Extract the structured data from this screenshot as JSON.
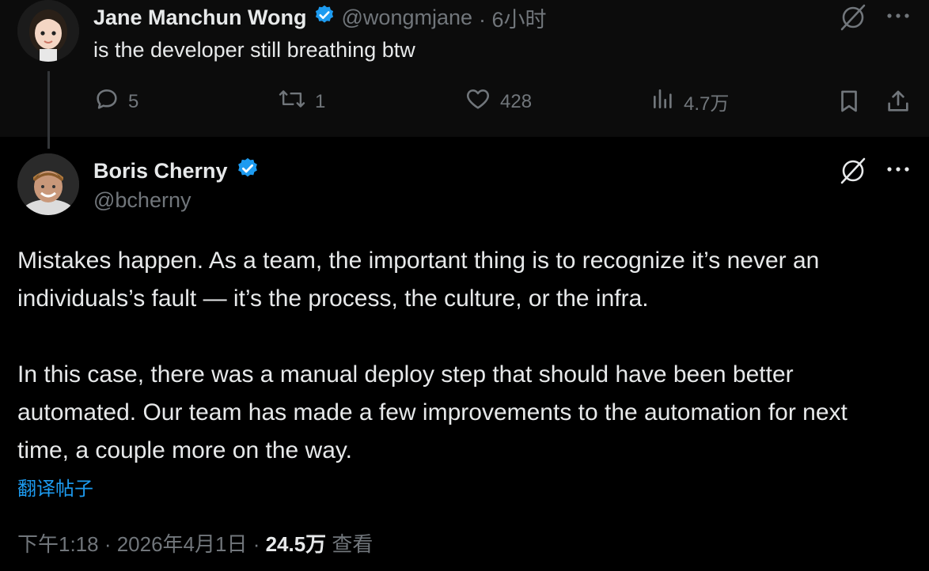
{
  "parent_tweet": {
    "name": "Jane Manchun Wong",
    "handle": "@wongmjane",
    "time": "· 6小时",
    "text": "is the developer still breathing btw",
    "replies": "5",
    "retweets": "1",
    "likes": "428",
    "views": "4.7万"
  },
  "main_tweet": {
    "name": "Boris Cherny",
    "handle": "@bcherny",
    "paragraphs": [
      "Mistakes happen. As a team, the important thing is to recognize it’s never an individuals’s fault — it’s the process, the culture, or the infra.",
      "In this case, there was a manual deploy step that should have been better automated. Our team has made a few improvements to the automation for next time, a couple more on the way."
    ],
    "translate": "翻译帖子",
    "time": "下午1:18 · 2026年4月1日 · ",
    "views": "24.5万",
    "views_label": " 查看"
  },
  "colors": {
    "accent": "#1d9bf0",
    "muted": "#71767b",
    "text": "#e7e9ea"
  },
  "icons": [
    "verified-badge-icon",
    "grok-icon",
    "more-icon",
    "reply-icon",
    "retweet-icon",
    "like-icon",
    "views-icon",
    "bookmark-icon",
    "share-icon"
  ]
}
